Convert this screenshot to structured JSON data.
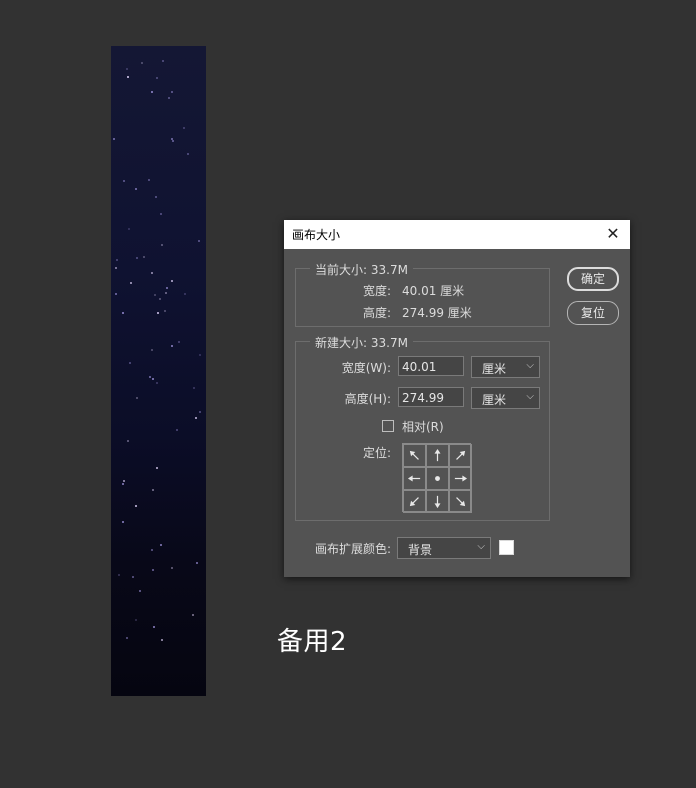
{
  "document": {
    "caption": "备用2"
  },
  "dialog": {
    "title": "画布大小",
    "close_symbol": "✕",
    "current_size": {
      "legend": "当前大小: 33.7M",
      "width_label": "宽度:",
      "width_value": "40.01 厘米",
      "height_label": "高度:",
      "height_value": "274.99 厘米"
    },
    "new_size": {
      "legend": "新建大小: 33.7M",
      "width_label": "宽度(W):",
      "width_value": "40.01",
      "width_unit": "厘米",
      "height_label": "高度(H):",
      "height_value": "274.99",
      "height_unit": "厘米",
      "relative_label": "相对(R)",
      "relative_checked": false,
      "anchor_label": "定位:"
    },
    "extension_color": {
      "label": "画布扩展颜色:",
      "value": "背景",
      "swatch_color": "#ffffff"
    },
    "buttons": {
      "ok": "确定",
      "reset": "复位"
    },
    "anchor_icons": [
      "arrow-up-left-icon",
      "arrow-up-icon",
      "arrow-up-right-icon",
      "arrow-left-icon",
      "center-dot-icon",
      "arrow-right-icon",
      "arrow-down-left-icon",
      "arrow-down-icon",
      "arrow-down-right-icon"
    ]
  }
}
